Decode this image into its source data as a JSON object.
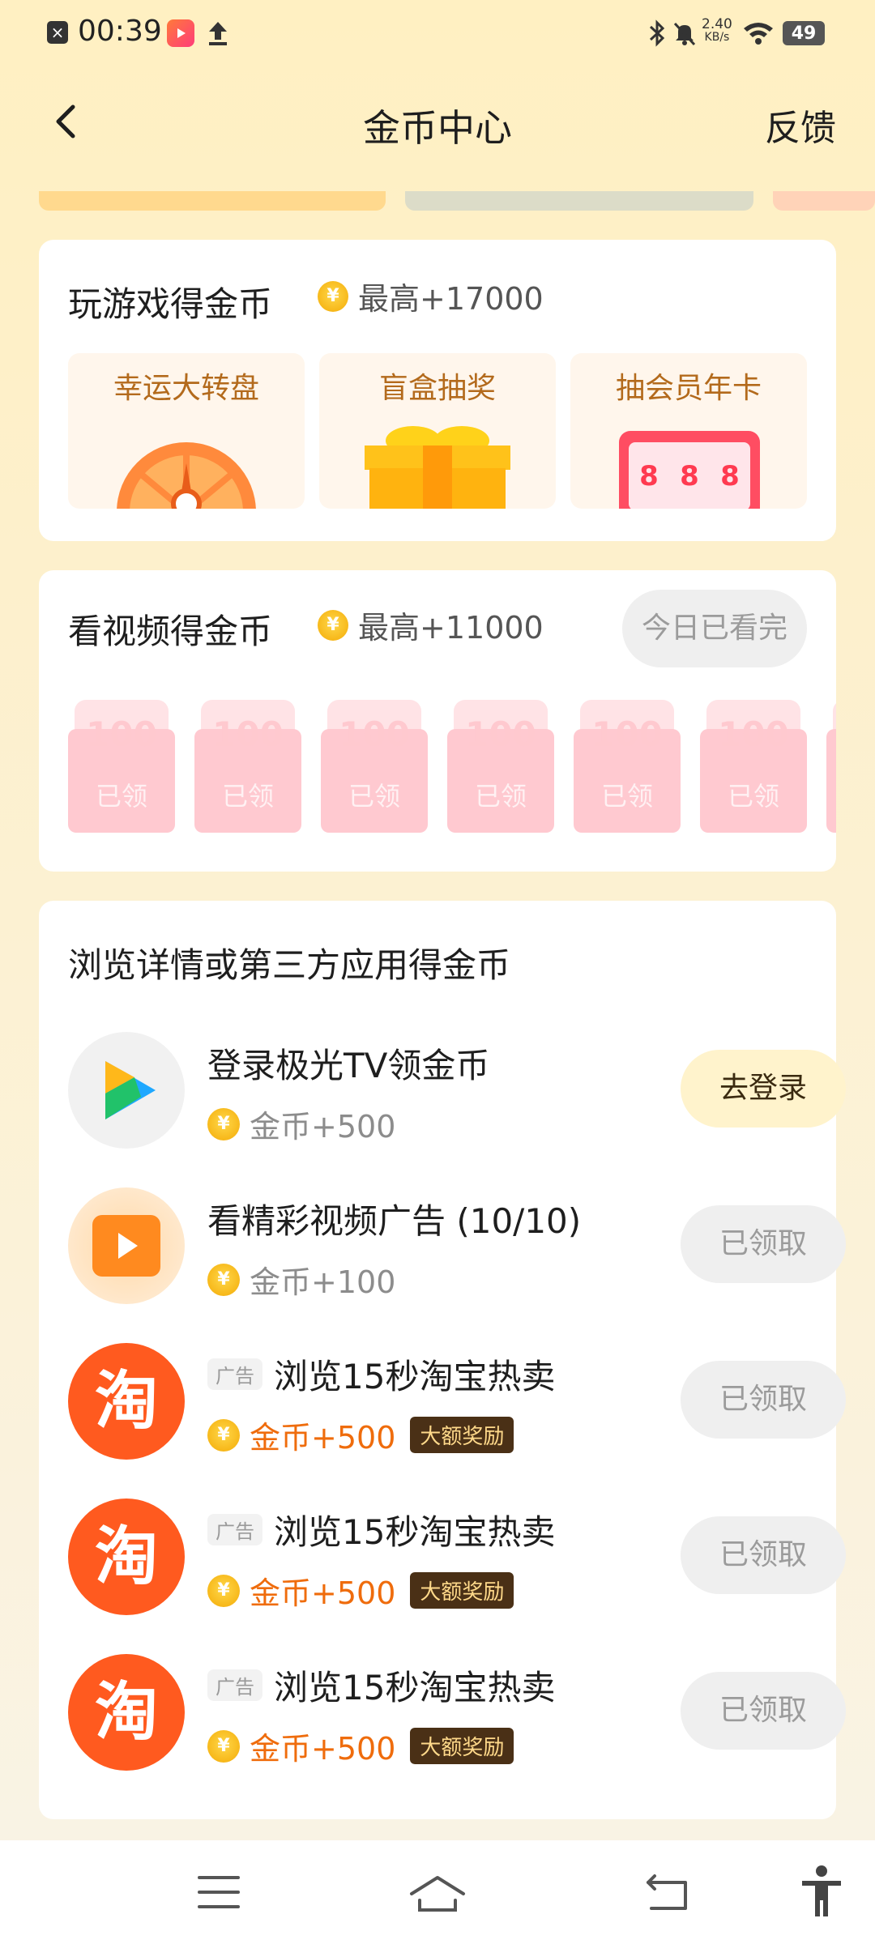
{
  "status_bar": {
    "time": "00:39",
    "net_speed_value": "2.40",
    "net_speed_unit": "KB/s",
    "battery": "49"
  },
  "nav": {
    "title": "金币中心",
    "feedback": "反馈"
  },
  "game_section": {
    "title": "玩游戏得金币",
    "max": "最高+17000",
    "tiles": [
      {
        "label": "幸运大转盘"
      },
      {
        "label": "盲盒抽奖"
      },
      {
        "label": "抽会员年卡",
        "digits": [
          "8",
          "8",
          "8"
        ]
      }
    ]
  },
  "video_section": {
    "title": "看视频得金币",
    "max": "最高+11000",
    "done_label": "今日已看完",
    "coins": [
      {
        "value": "100",
        "label": "已领"
      },
      {
        "value": "100",
        "label": "已领"
      },
      {
        "value": "100",
        "label": "已领"
      },
      {
        "value": "100",
        "label": "已领"
      },
      {
        "value": "100",
        "label": "已领"
      },
      {
        "value": "100",
        "label": "已领"
      }
    ]
  },
  "browse_section": {
    "title": "浏览详情或第三方应用得金币",
    "tasks": [
      {
        "name": "登录极光TV领金币",
        "reward": "金币+500",
        "button": "去登录"
      },
      {
        "name": "看精彩视频广告 (10/10)",
        "reward": "金币+100",
        "button": "已领取"
      },
      {
        "ad_tag": "广告",
        "name": "浏览15秒淘宝热卖",
        "reward": "金币+500",
        "badge": "大额奖励",
        "button": "已领取",
        "icon_char": "淘"
      },
      {
        "ad_tag": "广告",
        "name": "浏览15秒淘宝热卖",
        "reward": "金币+500",
        "badge": "大额奖励",
        "button": "已领取",
        "icon_char": "淘"
      },
      {
        "ad_tag": "广告",
        "name": "浏览15秒淘宝热卖",
        "reward": "金币+500",
        "badge": "大额奖励",
        "button": "已领取",
        "icon_char": "淘"
      }
    ]
  },
  "coin_symbol": "¥",
  "colors": {
    "accent_orange": "#ef6c0c",
    "brand_yellow": "#f7b81a",
    "taobao_orange": "#ff5a1f"
  }
}
